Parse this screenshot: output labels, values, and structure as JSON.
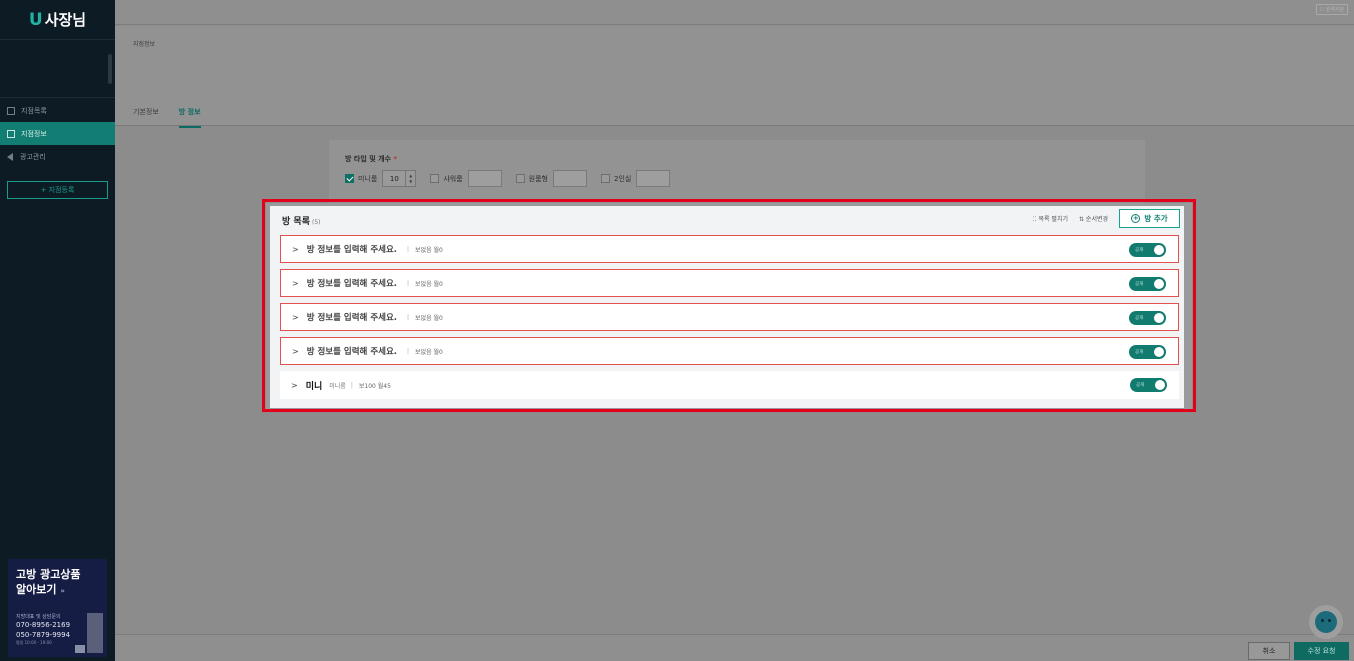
{
  "sidebar": {
    "logo_u": "U",
    "logo_text": "사장님",
    "items": [
      {
        "label": "지점목록"
      },
      {
        "label": "지점정보"
      },
      {
        "label": "광고관리"
      }
    ],
    "register_label": "+ 지점등록",
    "promo": {
      "title_line1": "고방 광고상품",
      "title_line2": "알아보기",
      "arrow": "»",
      "sub": "지방대표 및 상담문의",
      "phone1": "070-8956-2169",
      "phone2": "050-7879-9994",
      "hours": "평일 10:00 - 19:00"
    }
  },
  "topbar": {
    "link_label": "☐ 원격지원"
  },
  "header": {
    "crumb": "지점정보",
    "tabs": [
      {
        "label": "기본정보",
        "active": false
      },
      {
        "label": "방 정보",
        "active": true
      }
    ]
  },
  "room_type": {
    "label": "방 타입 및 개수",
    "required_mark": "*",
    "options": [
      {
        "label": "미니룸",
        "checked": true,
        "count": "10"
      },
      {
        "label": "샤워룸",
        "checked": false,
        "count": ""
      },
      {
        "label": "원룸형",
        "checked": false,
        "count": ""
      },
      {
        "label": "2인실",
        "checked": false,
        "count": ""
      }
    ]
  },
  "room_list": {
    "title": "방 목록",
    "count": "(5)",
    "expand_label": "⁚⁚ 목록 펼치기",
    "reorder_label": "⇅ 순서변경",
    "add_label": "방 추가",
    "rows": [
      {
        "title": "방 정보를 입력해 주세요.",
        "meta": "보없음 월0",
        "toggle": "공개"
      },
      {
        "title": "방 정보를 입력해 주세요.",
        "meta": "보없음 월0",
        "toggle": "공개"
      },
      {
        "title": "방 정보를 입력해 주세요.",
        "meta": "보없음 월0",
        "toggle": "공개"
      },
      {
        "title": "방 정보를 입력해 주세요.",
        "meta": "보없음 월0",
        "toggle": "공개"
      },
      {
        "title": "미니",
        "type": "미니룸",
        "meta": "보100 월45",
        "toggle": "공개"
      }
    ],
    "chevron": ">",
    "sep": "|"
  },
  "footer": {
    "cancel_label": "취소",
    "submit_label": "수정 요청"
  },
  "colors": {
    "accent": "#127b6f",
    "highlight": "#e3001b",
    "row_outline": "#e25050",
    "sidebar_bg": "#0c1b24"
  }
}
